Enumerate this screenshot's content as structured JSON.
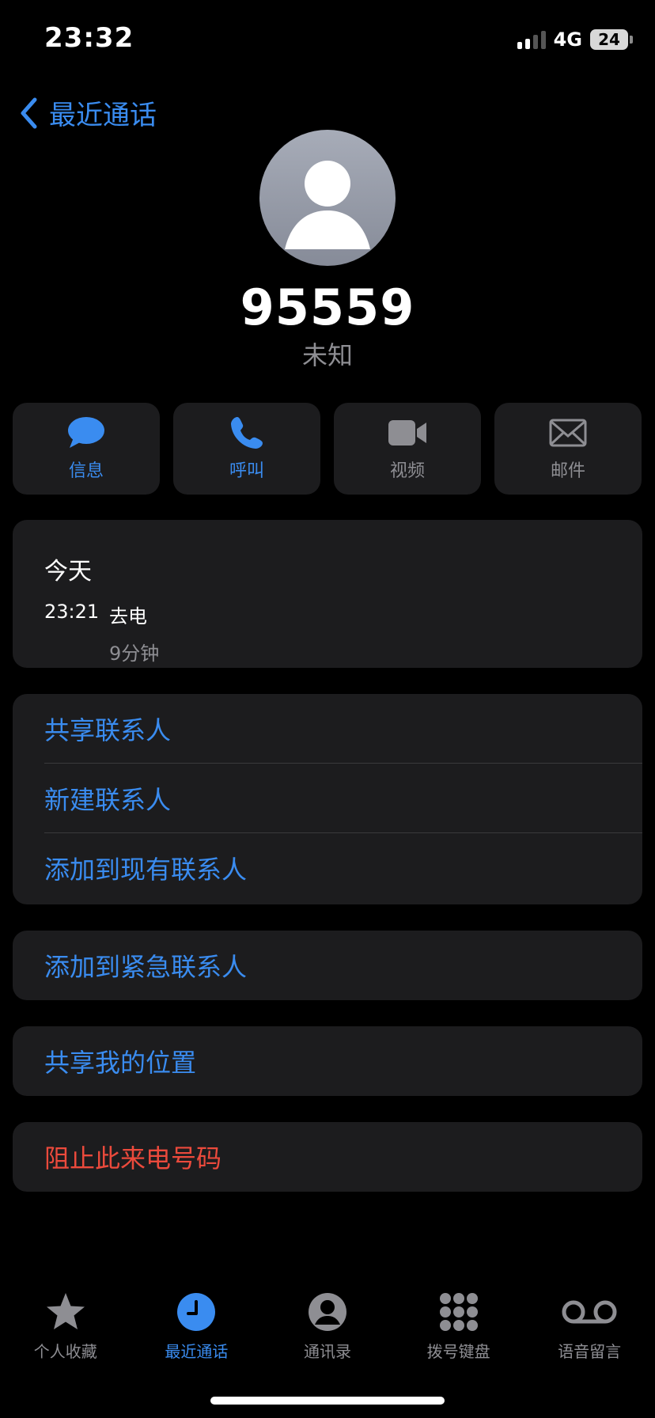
{
  "status_bar": {
    "time": "23:32",
    "network": "4G",
    "battery": "24"
  },
  "nav": {
    "back_label": "最近通话"
  },
  "contact": {
    "number": "95559",
    "label": "未知"
  },
  "actions": [
    {
      "label": "信息",
      "icon": "message-bubble-icon",
      "enabled": true
    },
    {
      "label": "呼叫",
      "icon": "phone-icon",
      "enabled": true
    },
    {
      "label": "视频",
      "icon": "video-camera-icon",
      "enabled": false
    },
    {
      "label": "邮件",
      "icon": "envelope-icon",
      "enabled": false
    }
  ],
  "call_history": {
    "date": "今天",
    "time": "23:21",
    "type": "去电",
    "duration": "9分钟"
  },
  "contact_options": [
    "共享联系人",
    "新建联系人",
    "添加到现有联系人"
  ],
  "emergency_option": "添加到紧急联系人",
  "location_option": "共享我的位置",
  "block_option": "阻止此来电号码",
  "tab_bar": [
    {
      "label": "个人收藏",
      "icon": "star-icon"
    },
    {
      "label": "最近通话",
      "icon": "clock-icon",
      "active": true
    },
    {
      "label": "通讯录",
      "icon": "person-circle-icon"
    },
    {
      "label": "拨号键盘",
      "icon": "keypad-icon"
    },
    {
      "label": "语音留言",
      "icon": "voicemail-icon"
    }
  ],
  "colors": {
    "accent": "#3a8cf0",
    "destructive": "#eb4a3c",
    "card": "#1c1c1e",
    "secondary_text": "#8e8e93"
  }
}
